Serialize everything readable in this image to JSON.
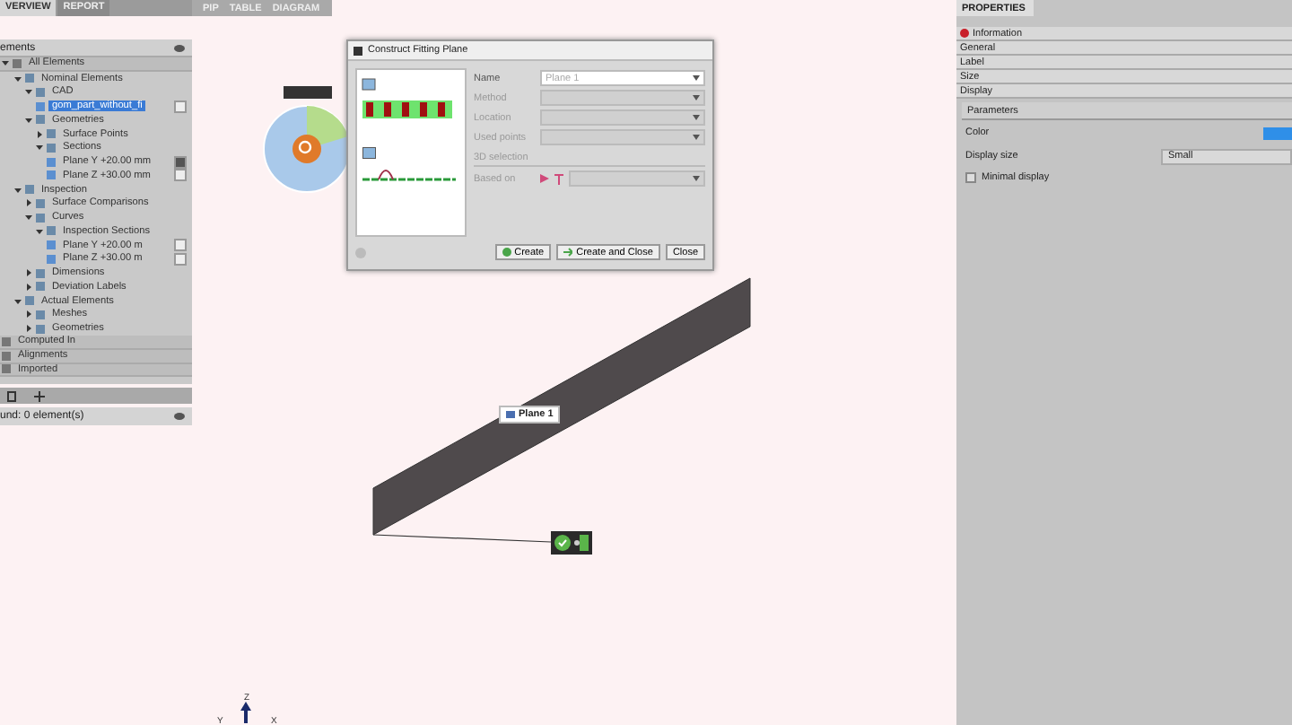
{
  "left_panel": {
    "tabs": [
      {
        "label": "VERVIEW",
        "selected": true
      },
      {
        "label": "REPORT",
        "selected": false
      }
    ],
    "header": "ements",
    "tree": [
      {
        "label": "All Elements",
        "kind": "category",
        "selected": false,
        "expanded": true,
        "children": [
          {
            "label": "Nominal Elements",
            "selected": false,
            "expanded": true,
            "children": [
              {
                "label": "CAD",
                "selected": false,
                "expanded": true,
                "children": [
                  {
                    "label": "gom_part_without_fi",
                    "selected": true,
                    "checked": false
                  }
                ]
              },
              {
                "label": "Geometries",
                "selected": false,
                "expanded": true,
                "children": [
                  {
                    "label": "Surface Points",
                    "selected": false,
                    "expanded": false
                  },
                  {
                    "label": "Sections",
                    "selected": false,
                    "expanded": true,
                    "children": [
                      {
                        "label": "Plane Y +20.00 mm",
                        "selected": false,
                        "checked": true
                      },
                      {
                        "label": "Plane Z +30.00 mm",
                        "selected": false,
                        "checked": false
                      }
                    ]
                  }
                ]
              }
            ]
          },
          {
            "label": "Inspection",
            "selected": false,
            "expanded": true,
            "children": [
              {
                "label": "Surface Comparisons",
                "selected": false,
                "expanded": false
              },
              {
                "label": "Curves",
                "selected": false,
                "expanded": true,
                "children": [
                  {
                    "label": "Inspection Sections",
                    "selected": false,
                    "expanded": true,
                    "children": [
                      {
                        "label": "Plane Y +20.00 m",
                        "selected": false,
                        "checked": false
                      },
                      {
                        "label": "Plane Z +30.00 m",
                        "selected": false,
                        "checked": false
                      }
                    ]
                  }
                ]
              },
              {
                "label": "Dimensions",
                "selected": false,
                "expanded": false
              },
              {
                "label": "Deviation Labels",
                "selected": false,
                "expanded": false
              }
            ]
          },
          {
            "label": "Actual Elements",
            "selected": false,
            "expanded": true,
            "children": [
              {
                "label": "Meshes",
                "selected": false,
                "expanded": false
              },
              {
                "label": "Geometries",
                "selected": false,
                "expanded": false
              }
            ]
          }
        ]
      },
      {
        "label": "Computed In",
        "kind": "category",
        "selected": false
      },
      {
        "label": "Alignments",
        "kind": "category",
        "selected": false
      },
      {
        "label": "Imported",
        "kind": "category",
        "selected": false
      }
    ],
    "status": "und: 0 element(s)"
  },
  "viewport": {
    "tabs": [
      {
        "label": "PIP"
      },
      {
        "label": "TABLE"
      },
      {
        "label": "DIAGRAM"
      }
    ],
    "plane_label": "Plane 1",
    "axes": [
      "Y",
      "Z",
      "X"
    ]
  },
  "dialog": {
    "title": "Construct Fitting Plane",
    "fields": [
      {
        "label": "Name",
        "kind": "text",
        "value": "Plane 1",
        "disabled": false
      },
      {
        "label": "Method",
        "kind": "select",
        "disabled": true
      },
      {
        "label": "Location",
        "kind": "select",
        "disabled": true
      },
      {
        "label": "Used points",
        "kind": "select",
        "disabled": true
      },
      {
        "label": "3D selection",
        "kind": "heading",
        "disabled": true
      },
      {
        "label": "Based on",
        "kind": "based",
        "disabled": true
      }
    ],
    "buttons": [
      {
        "label": "Create",
        "kind": "check"
      },
      {
        "label": "Create and Close",
        "kind": "arrow"
      },
      {
        "label": "Close",
        "kind": "plain"
      }
    ]
  },
  "properties": {
    "title": "PROPERTIES",
    "sections": [
      {
        "label": "Information",
        "kind": "info"
      },
      {
        "label": "General",
        "kind": "plain"
      },
      {
        "label": "Label",
        "kind": "plain"
      },
      {
        "label": "Size",
        "kind": "plain"
      },
      {
        "label": "Display",
        "kind": "plain"
      }
    ],
    "parameters": {
      "title": "Parameters",
      "color": {
        "label": "Color",
        "color": "#2f8fe8"
      },
      "display_size": {
        "label": "Display size",
        "value": "Small"
      },
      "minimal_display": {
        "label": "Minimal display",
        "checked": false
      }
    }
  }
}
